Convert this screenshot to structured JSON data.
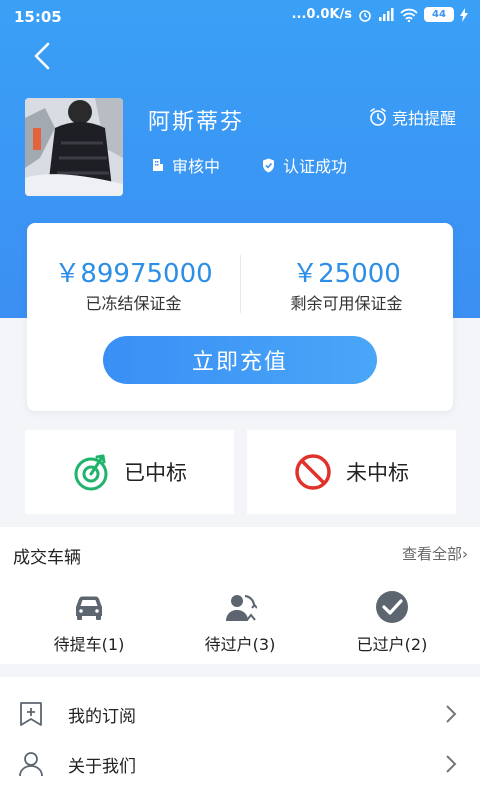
{
  "status_bar": {
    "time": "15:05",
    "network_speed": "...0.0K/s",
    "battery": "44"
  },
  "profile": {
    "name": "阿斯蒂芬",
    "auction_reminder": "竞拍提醒",
    "review_status": "审核中",
    "verify_status": "认证成功"
  },
  "deposit": {
    "frozen_amount": "￥89975000",
    "frozen_label": "已冻结保证金",
    "available_amount": "￥25000",
    "available_label": "剩余可用保证金",
    "recharge_button": "立即充值"
  },
  "bids": {
    "won_label": "已中标",
    "lost_label": "未中标"
  },
  "deals": {
    "title": "成交车辆",
    "view_all": "查看全部",
    "items": [
      {
        "label": "待提车(1)",
        "icon": "car-icon"
      },
      {
        "label": "待过户(3)",
        "icon": "transfer-icon"
      },
      {
        "label": "已过户(2)",
        "icon": "check-circle-icon"
      }
    ]
  },
  "menu": {
    "items": [
      {
        "label": "我的订阅",
        "icon": "bookmark-add-icon"
      },
      {
        "label": "关于我们",
        "icon": "user-icon"
      }
    ]
  },
  "colors": {
    "primary": "#3b93f3",
    "amount": "#2c8ee6",
    "won_green": "#1fb36b",
    "lost_red": "#e0322b",
    "icon_gray": "#5d6670"
  }
}
